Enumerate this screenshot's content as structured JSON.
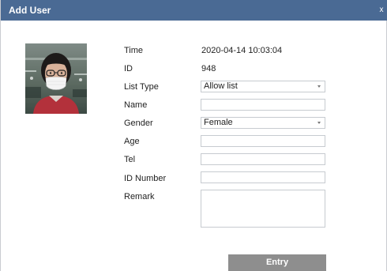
{
  "window": {
    "title": "Add User",
    "close_glyph": "x"
  },
  "photo": {
    "icon": "user-face-photo"
  },
  "form": {
    "time": {
      "label": "Time",
      "value": "2020-04-14 10:03:04"
    },
    "id": {
      "label": "ID",
      "value": "948"
    },
    "list_type": {
      "label": "List Type",
      "value": "Allow list"
    },
    "name": {
      "label": "Name",
      "value": ""
    },
    "gender": {
      "label": "Gender",
      "value": "Female"
    },
    "age": {
      "label": "Age",
      "value": ""
    },
    "tel": {
      "label": "Tel",
      "value": ""
    },
    "id_number": {
      "label": "ID Number",
      "value": ""
    },
    "remark": {
      "label": "Remark",
      "value": ""
    }
  },
  "actions": {
    "entry_label": "Entry"
  },
  "colors": {
    "titlebar": "#4a6a94",
    "button": "#8e8e8e",
    "border": "#c7cbd0"
  }
}
